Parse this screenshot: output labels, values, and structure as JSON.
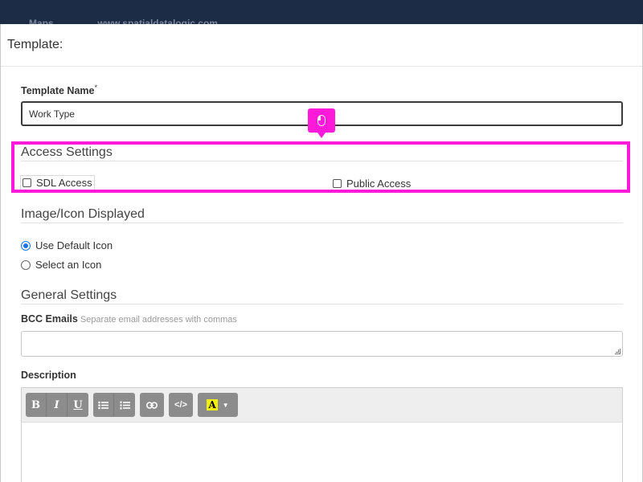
{
  "background_bar": {
    "nav_item": "Maps",
    "site": "www.spatialdatalogic.com"
  },
  "modal": {
    "title": "Template:"
  },
  "template_name": {
    "label": "Template Name",
    "required_marker": "*",
    "value": "Work Type"
  },
  "access_settings": {
    "title": "Access Settings",
    "sdl_access": {
      "label": "SDL Access",
      "checked": false
    },
    "public_access": {
      "label": "Public Access",
      "checked": false
    }
  },
  "image_icon": {
    "title": "Image/Icon Displayed",
    "options": [
      {
        "label": "Use Default Icon",
        "selected": true
      },
      {
        "label": "Select an Icon",
        "selected": false
      }
    ]
  },
  "general_settings": {
    "title": "General Settings",
    "bcc_label": "BCC Emails",
    "bcc_hint": "Separate email addresses with commas",
    "bcc_value": ""
  },
  "description": {
    "label": "Description",
    "toolbar": {
      "bold": "B",
      "italic": "I",
      "underline": "U",
      "code": "</>",
      "highlight": "A"
    }
  },
  "overlay": {
    "highlight_color": "#ff1ad9",
    "badge_icon": "mouse-icon"
  },
  "colors": {
    "topbar": "#1c2b46",
    "radio_selected": "#1a73e8",
    "toolbar_button": "#8c8c8c",
    "highlight_swatch": "#f3f000"
  }
}
